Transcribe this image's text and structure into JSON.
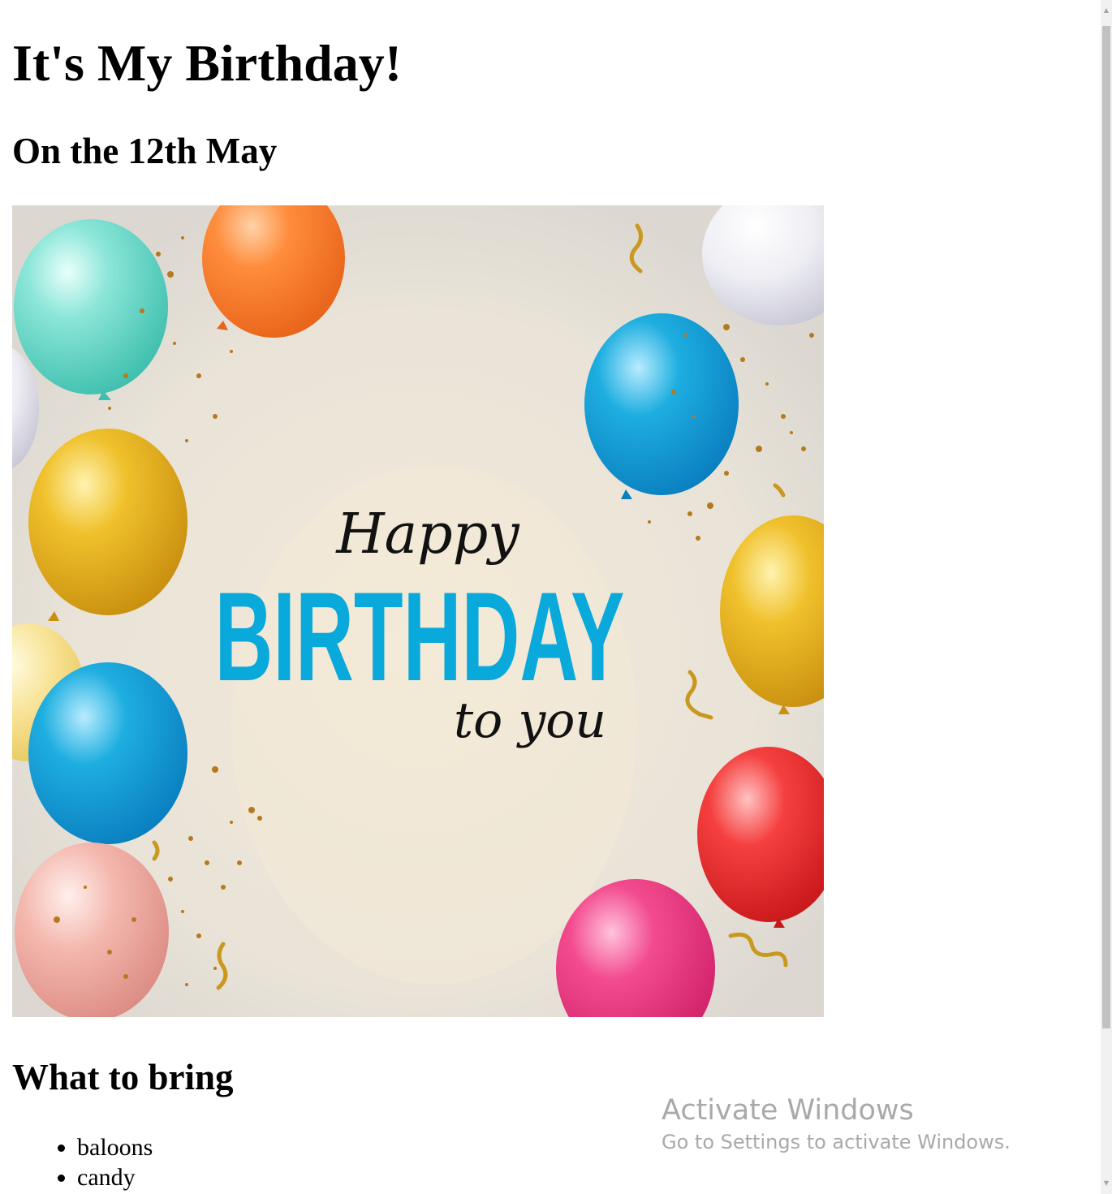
{
  "page": {
    "title": "It's My Birthday!",
    "date_heading": "On the 12th May",
    "banner": {
      "script_top": "Happy",
      "main_word": "BIRTHDAY",
      "script_bottom": "to you",
      "main_color": "#0aa9db",
      "background_color": "#ebe5d9"
    },
    "bring_heading": "What to bring",
    "bring_items": [
      "baloons",
      "candy"
    ]
  },
  "watermark": {
    "title": "Activate Windows",
    "subtitle": "Go to Settings to activate Windows."
  },
  "scrollbar": {
    "up_icon": "scroll-up-arrow-icon",
    "down_icon": "scroll-down-arrow-icon"
  }
}
